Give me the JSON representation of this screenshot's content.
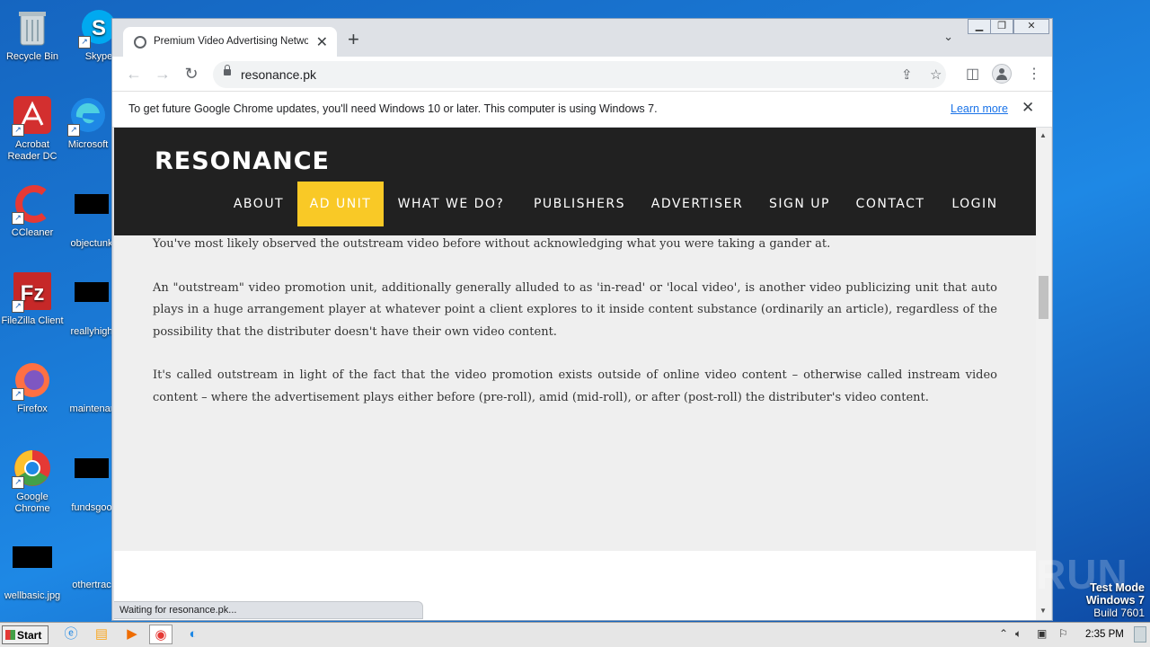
{
  "desktop": {
    "icons": [
      {
        "label": "Recycle Bin"
      },
      {
        "label": "Skype"
      },
      {
        "label": "Acrobat Reader DC"
      },
      {
        "label": "Microsoft"
      },
      {
        "label": "CCleaner"
      },
      {
        "label": "objectunk"
      },
      {
        "label": "FileZilla Client"
      },
      {
        "label": "reallyhigh"
      },
      {
        "label": "Firefox"
      },
      {
        "label": "maintenar"
      },
      {
        "label": "Google Chrome"
      },
      {
        "label": "fundsgoo"
      },
      {
        "label": "wellbasic.jpg"
      },
      {
        "label": "othertrac"
      }
    ]
  },
  "browser": {
    "tab_title": "Premium Video Advertising Network",
    "url": "resonance.pk",
    "infobar_message": "To get future Google Chrome updates, you'll need Windows 10 or later. This computer is using Windows 7.",
    "infobar_link": "Learn more",
    "status_text": "Waiting for resonance.pk..."
  },
  "site": {
    "logo": "RESONANCE",
    "nav": [
      "ABOUT",
      "AD UNIT",
      "WHAT WE DO?",
      "PUBLISHERS",
      "ADVERTISER",
      "SIGN UP",
      "CONTACT",
      "LOGIN"
    ],
    "active_nav": "AD UNIT",
    "accent_color": "#f9c926",
    "paragraphs": [
      "You've most likely observed the outstream video before without acknowledging what you were taking a gander at.",
      "An \"outstream\" video promotion unit, additionally generally alluded to as 'in-read' or 'local video', is another video publicizing unit that auto plays in a huge arrangement player at whatever point a client explores to it inside content substance (ordinarily an article), regardless of the possibility that the distributer doesn't have their own video content.",
      "It's called outstream in light of the fact that the video promotion exists outside of online video content – otherwise called instream video content – where the advertisement plays either before (pre-roll), amid (mid-roll), or after (post-roll) the distributer's video content."
    ]
  },
  "watermark": "ANY RUN",
  "test_mode": {
    "line1": "Test Mode",
    "line2": "Windows 7",
    "line3": "Build 7601"
  },
  "taskbar": {
    "start_label": "Start",
    "clock": "2:35 PM"
  }
}
